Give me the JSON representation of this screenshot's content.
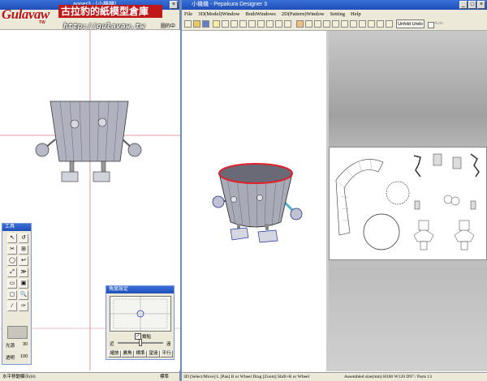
{
  "left_window": {
    "title_fragment": "agner3 - [小機機]",
    "right_snip_label": "圖的中前",
    "status_left": "水平移動顯示(H)",
    "status_right": "標準"
  },
  "logo": {
    "brand": "Gulavaw",
    "brand_sub": "TW",
    "title": "古拉豹的紙模型倉庫",
    "url": "http://gulavaw.tw"
  },
  "tool_palette": {
    "title": "工具",
    "tools": [
      "↖",
      "↺",
      "✂",
      "⊞",
      "◯",
      "↩",
      "⤢",
      "≫",
      "▭",
      "▣",
      "▢",
      "🔍",
      "∕",
      "✑"
    ],
    "light_label": "光源",
    "light_value": "30",
    "trans_label": "透明",
    "trans_value": "100"
  },
  "angle_palette": {
    "title": "角度設定",
    "checkbox_label": "鎖點",
    "near_label": "近",
    "far_label": "遠",
    "buttons": [
      "縮放",
      "廣角",
      "標準",
      "望遠",
      "平行"
    ]
  },
  "right_window": {
    "title": "小機機 - Pepakura Designer 3",
    "menu": [
      "File",
      "3D(Model)Window",
      "BothWindows",
      "2D(Pattern)Window",
      "Setting",
      "Help"
    ],
    "unfold_button": "Unfold Undo",
    "auto_label": "Auto",
    "status_left": "3D [Select/Move] L [Pan] R or Wheel Drag [Zoom] Shift+R or Wheel",
    "status_right": "Assembled size(mm) H100 W120 D97 / Parts 13"
  },
  "colors": {
    "titlebar": "#2a5fc8",
    "chrome": "#ece9d8",
    "edge_red": "#e0202a",
    "crosshair": "#e07a8a",
    "body_gray": "#a8aab8"
  }
}
